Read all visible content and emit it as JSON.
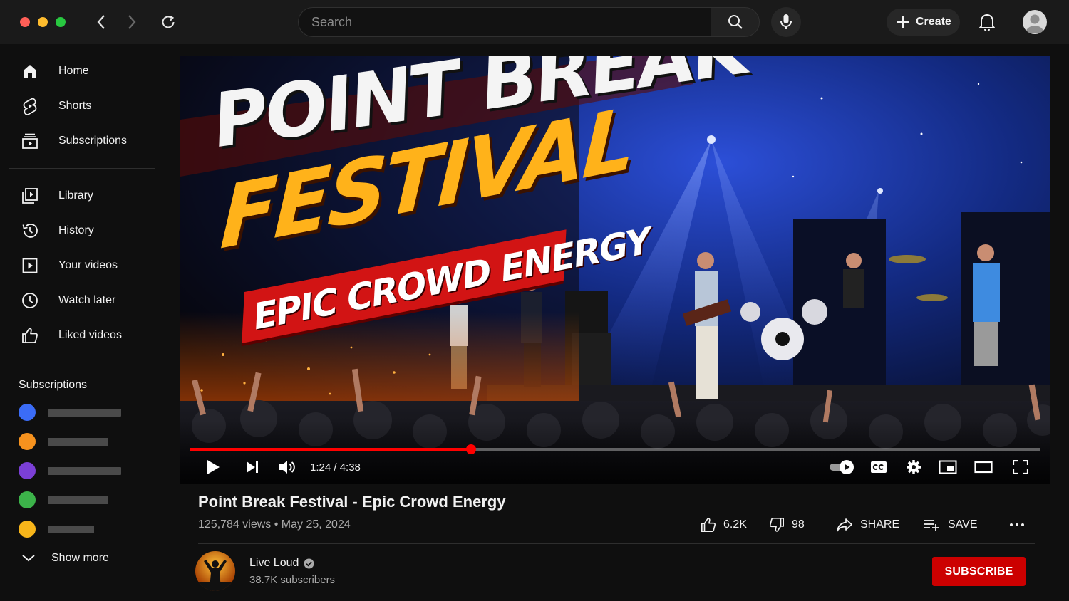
{
  "window": {
    "traffic_colors": [
      "#ff5f57",
      "#febc2e",
      "#28c840"
    ]
  },
  "topbar": {
    "search_placeholder": "Search",
    "create_label": "Create"
  },
  "sidebar": {
    "primary": [
      {
        "label": "Home",
        "icon": "home-icon"
      },
      {
        "label": "Shorts",
        "icon": "shorts-icon"
      },
      {
        "label": "Subscriptions",
        "icon": "subscriptions-icon"
      }
    ],
    "secondary": [
      {
        "label": "Library",
        "icon": "library-icon"
      },
      {
        "label": "History",
        "icon": "history-icon"
      },
      {
        "label": "Your videos",
        "icon": "your-videos-icon"
      },
      {
        "label": "Watch later",
        "icon": "clock-icon"
      },
      {
        "label": "Liked videos",
        "icon": "thumbs-up-icon"
      }
    ],
    "subscriptions_heading": "Subscriptions",
    "subscription_colors": [
      "#3b6cf6",
      "#f6921e",
      "#7b3fd6",
      "#3cb34a",
      "#f7b51a"
    ],
    "show_more": "Show more"
  },
  "thumbnail": {
    "line1": "POINT BREAK",
    "line2": "FESTIVAL",
    "line3": "EPIC CROWD ENERGY"
  },
  "player": {
    "current_time": "1:24",
    "duration": "4:38",
    "time_display": "1:24 / 4:38",
    "progress_fraction": 0.33,
    "accent_color": "#ff0000"
  },
  "video": {
    "title": "Point Break Festival - Epic Crowd Energy",
    "views": "125,784 views",
    "date": "May 25, 2024",
    "meta": "125,784 views • May 25, 2024",
    "likes": "6.2K",
    "dislikes": "98",
    "share_label": "SHARE",
    "save_label": "SAVE"
  },
  "channel": {
    "name": "Live Loud",
    "subscribers": "38.7K subscribers",
    "subscribe_label": "SUBSCRIBE",
    "subscribe_color": "#cc0000"
  }
}
